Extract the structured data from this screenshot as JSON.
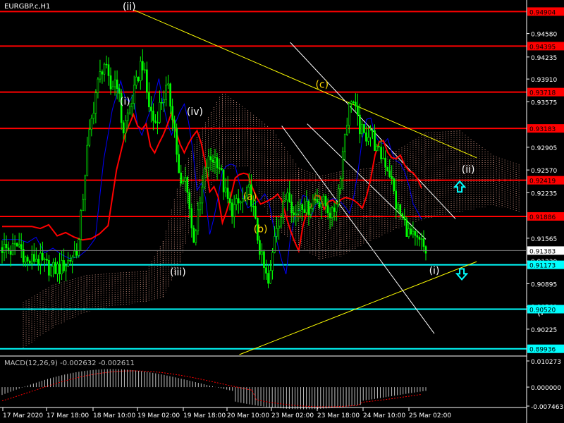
{
  "symbol_title": "EURGBP.c,H1",
  "macd_label": "MACD(12,26,9) -0.002632 -0.002611",
  "colors": {
    "background": "#000000",
    "candle": "#00ff00",
    "resistance": "#ff0000",
    "support": "#00ffff",
    "trendline": "#ffff00",
    "channel": "#ffffff",
    "ichimoku_cloud": "#ffb4a0",
    "ma_red": "#ff0000",
    "ma_blue": "#0000ff",
    "macd_hist": "#c0c0c0",
    "macd_signal": "#ff0000",
    "wave_label_white": "#ffffff",
    "wave_label_yellow": "#ffd700"
  },
  "chart_data": {
    "type": "candlestick",
    "symbol": "EURGBP.c",
    "timeframe": "H1",
    "ylim": [
      0.8985,
      0.9495
    ],
    "price_axis_ticks": [
      "0.94580",
      "0.94235",
      "0.93910",
      "0.93575",
      "0.92905",
      "0.92570",
      "0.92235",
      "0.91565",
      "0.91230",
      "0.90895",
      "0.90560",
      "0.90225"
    ],
    "price_ticks_num": [
      0.9458,
      0.94235,
      0.9391,
      0.93575,
      0.92905,
      0.9257,
      0.92235,
      0.91565,
      0.9123,
      0.90895,
      0.9056,
      0.90225
    ],
    "time_axis_labels": [
      "17 Mar 2020",
      "17 Mar 18:00",
      "18 Mar 10:00",
      "19 Mar 02:00",
      "19 Mar 18:00",
      "20 Mar 10:00",
      "23 Mar 02:00",
      "23 Mar 18:00",
      "24 Mar 10:00",
      "25 Mar 02:00"
    ],
    "horizontal_levels": [
      {
        "label": "0.94904",
        "value": 0.94904,
        "kind": "resistance"
      },
      {
        "label": "0.94395",
        "value": 0.94395,
        "kind": "resistance"
      },
      {
        "label": "0.93718",
        "value": 0.93718,
        "kind": "resistance"
      },
      {
        "label": "0.93183",
        "value": 0.93183,
        "kind": "resistance"
      },
      {
        "label": "0.92419",
        "value": 0.92419,
        "kind": "resistance"
      },
      {
        "label": "0.91886",
        "value": 0.91886,
        "kind": "resistance"
      },
      {
        "label": "0.91173",
        "value": 0.91173,
        "kind": "support"
      },
      {
        "label": "0.90520",
        "value": 0.9052,
        "kind": "support"
      },
      {
        "label": "0.89936",
        "value": 0.89936,
        "kind": "support"
      }
    ],
    "current_price": {
      "label": "0.91383",
      "value": 0.91383
    },
    "close_path": [
      [
        0,
        0.9143
      ],
      [
        0.02,
        0.9138
      ],
      [
        0.04,
        0.9147
      ],
      [
        0.06,
        0.912
      ],
      [
        0.08,
        0.9128
      ],
      [
        0.1,
        0.9117
      ],
      [
        0.12,
        0.911
      ],
      [
        0.14,
        0.9113
      ],
      [
        0.16,
        0.9125
      ],
      [
        0.18,
        0.9145
      ],
      [
        0.2,
        0.9282
      ],
      [
        0.22,
        0.9368
      ],
      [
        0.24,
        0.9418
      ],
      [
        0.255,
        0.9375
      ],
      [
        0.27,
        0.9395
      ],
      [
        0.285,
        0.9312
      ],
      [
        0.3,
        0.9347
      ],
      [
        0.315,
        0.9378
      ],
      [
        0.33,
        0.9422
      ],
      [
        0.345,
        0.9356
      ],
      [
        0.36,
        0.9324
      ],
      [
        0.375,
        0.9358
      ],
      [
        0.39,
        0.9378
      ],
      [
        0.405,
        0.9332
      ],
      [
        0.42,
        0.9228
      ],
      [
        0.435,
        0.9247
      ],
      [
        0.45,
        0.9152
      ],
      [
        0.465,
        0.9195
      ],
      [
        0.48,
        0.9262
      ],
      [
        0.495,
        0.9275
      ],
      [
        0.51,
        0.9271
      ],
      [
        0.525,
        0.9225
      ],
      [
        0.54,
        0.9198
      ],
      [
        0.555,
        0.9205
      ],
      [
        0.57,
        0.9213
      ],
      [
        0.585,
        0.9227
      ],
      [
        0.6,
        0.9168
      ],
      [
        0.615,
        0.9118
      ],
      [
        0.63,
        0.9083
      ],
      [
        0.645,
        0.9175
      ],
      [
        0.66,
        0.9192
      ],
      [
        0.675,
        0.9233
      ],
      [
        0.69,
        0.9185
      ],
      [
        0.705,
        0.9213
      ],
      [
        0.72,
        0.9198
      ],
      [
        0.735,
        0.9215
      ],
      [
        0.75,
        0.9212
      ],
      [
        0.765,
        0.9205
      ],
      [
        0.78,
        0.9188
      ],
      [
        0.795,
        0.9232
      ],
      [
        0.81,
        0.9318
      ],
      [
        0.825,
        0.9368
      ],
      [
        0.84,
        0.9325
      ],
      [
        0.855,
        0.9305
      ],
      [
        0.87,
        0.9318
      ],
      [
        0.885,
        0.9282
      ],
      [
        0.9,
        0.9275
      ],
      [
        0.915,
        0.9253
      ],
      [
        0.93,
        0.9205
      ],
      [
        0.945,
        0.9185
      ],
      [
        0.96,
        0.9163
      ],
      [
        0.975,
        0.9152
      ],
      [
        0.99,
        0.9148
      ],
      [
        1,
        0.9137
      ]
    ],
    "macd": {
      "ylim": [
        -0.00746,
        0.01027
      ],
      "ticks": [
        "0.010273",
        "0.000000",
        "-0.007463"
      ]
    }
  },
  "wave_labels": [
    {
      "text": "(ii)",
      "color": "white",
      "price": 0.9493,
      "t": 0.3
    },
    {
      "text": "(i)",
      "color": "white",
      "price": 0.9353,
      "t": 0.29
    },
    {
      "text": "(iv)",
      "color": "white",
      "price": 0.9338,
      "t": 0.455
    },
    {
      "text": "(iii)",
      "color": "white",
      "price": 0.9102,
      "t": 0.415
    },
    {
      "text": "(a)",
      "color": "yellow",
      "price": 0.9213,
      "t": 0.585
    },
    {
      "text": "(b)",
      "color": "yellow",
      "price": 0.9165,
      "t": 0.61
    },
    {
      "text": "(c)",
      "color": "yellow",
      "price": 0.9378,
      "t": 0.755
    },
    {
      "text": "(ii)",
      "color": "white",
      "price": 0.9253,
      "t": 1.1
    },
    {
      "text": "(i)",
      "color": "white",
      "price": 0.9104,
      "t": 1.02
    },
    {
      "text": "(i",
      "color": "white",
      "price": 0.9043,
      "t": 1.27
    }
  ],
  "arrows": [
    {
      "direction": "up",
      "price": 0.9232,
      "t": 1.08
    },
    {
      "direction": "down",
      "price": 0.9104,
      "t": 1.085
    }
  ]
}
